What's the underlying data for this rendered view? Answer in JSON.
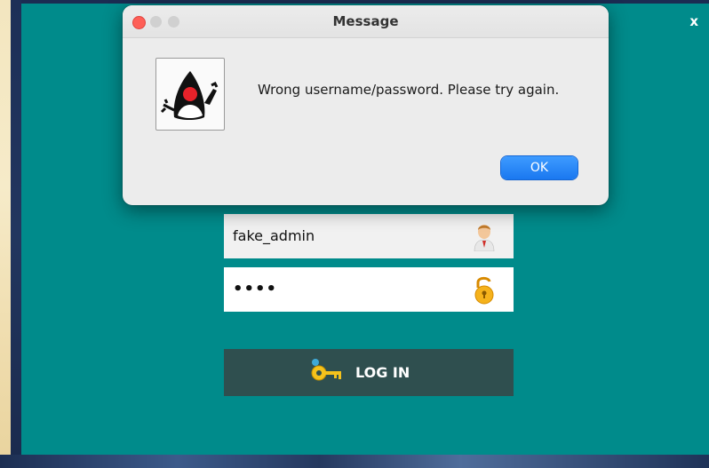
{
  "app": {
    "close_label": "x",
    "background_color": "#008b8b",
    "username": {
      "value": "fake_admin",
      "icon": "user-icon"
    },
    "password": {
      "value": "••••",
      "icon": "unlocked-padlock-icon"
    },
    "login_button": {
      "label": "LOG IN",
      "icon": "key-icon",
      "color": "#2f4f4f"
    }
  },
  "dialog": {
    "title": "Message",
    "message": "Wrong username/password. Please try again.",
    "ok_label": "OK",
    "icon": "java-duke-icon",
    "accent_color": "#1a78f0",
    "window_controls": [
      "close",
      "minimize",
      "zoom"
    ]
  }
}
